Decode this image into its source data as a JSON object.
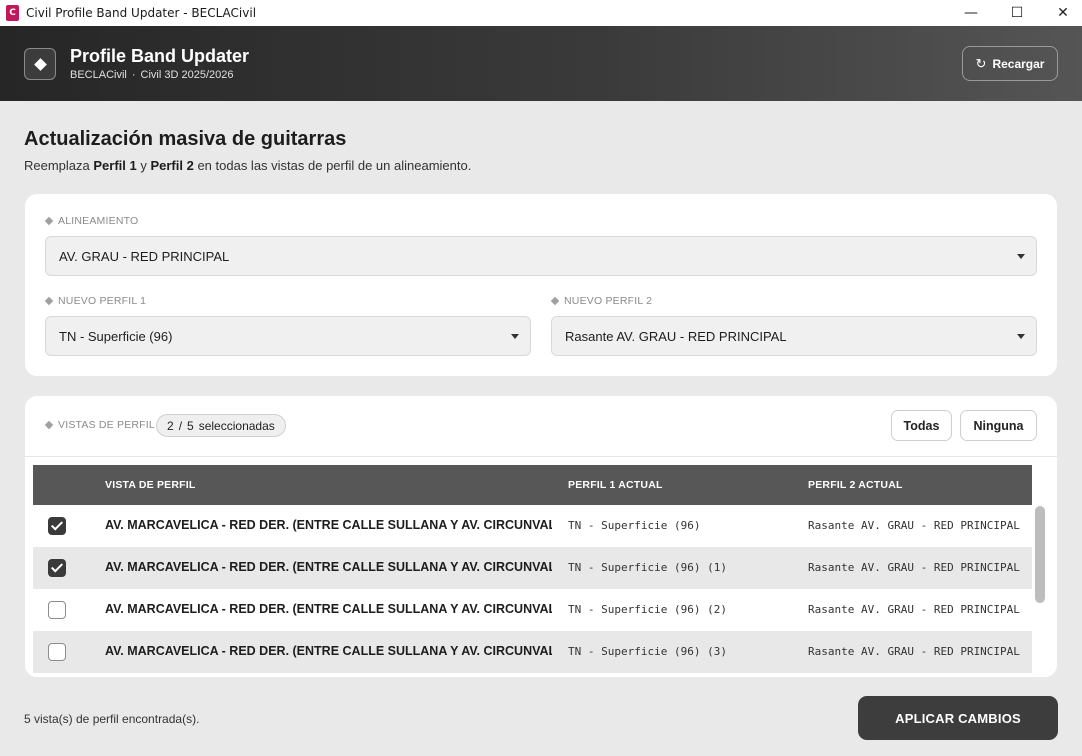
{
  "window": {
    "app_icon_label": "C",
    "title": "Civil Profile Band Updater - BECLACivil",
    "minimize": "—",
    "maximize": "☐",
    "close": "✕"
  },
  "header": {
    "title": "Profile Band Updater",
    "org": "BECLACivil",
    "separator": "·",
    "version": "Civil 3D 2025/2026",
    "reload_icon": "↻",
    "reload_label": "Recargar"
  },
  "page": {
    "title": "Actualización masiva de guitarras",
    "desc_prefix": "Reemplaza ",
    "desc_b1": "Perfil 1",
    "desc_mid": " y ",
    "desc_b2": "Perfil 2",
    "desc_suffix": " en todas las vistas de perfil de un alineamiento."
  },
  "form": {
    "alignment_label": "ALINEAMIENTO",
    "alignment_value": "AV. GRAU - RED PRINCIPAL",
    "profile1_label": "NUEVO PERFIL 1",
    "profile1_value": "TN - Superficie (96)",
    "profile2_label": "NUEVO PERFIL 2",
    "profile2_value": "Rasante AV. GRAU - RED PRINCIPAL"
  },
  "views": {
    "label": "VISTAS DE PERFIL",
    "selected_count": "2",
    "count_sep": "/",
    "total_count": "5",
    "count_suffix": "seleccionadas",
    "all_button": "Todas",
    "none_button": "Ninguna",
    "columns": [
      "VISTA DE PERFIL",
      "PERFIL 1 ACTUAL",
      "PERFIL 2 ACTUAL"
    ],
    "rows": [
      {
        "checked": true,
        "name": "AV. MARCAVELICA - RED DER. (ENTRE CALLE SULLANA Y AV. CIRCUNVALACION)",
        "profile1": "TN - Superficie (96)",
        "profile2": "Rasante AV. GRAU - RED PRINCIPAL"
      },
      {
        "checked": true,
        "name": "AV. MARCAVELICA - RED DER. (ENTRE CALLE SULLANA Y AV. CIRCUNVALACION)",
        "profile1": "TN - Superficie (96) (1)",
        "profile2": "Rasante AV. GRAU - RED PRINCIPAL"
      },
      {
        "checked": false,
        "name": "AV. MARCAVELICA - RED DER. (ENTRE CALLE SULLANA Y AV. CIRCUNVALACION)",
        "profile1": "TN - Superficie (96) (2)",
        "profile2": "Rasante AV. GRAU - RED PRINCIPAL"
      },
      {
        "checked": false,
        "name": "AV. MARCAVELICA - RED DER. (ENTRE CALLE SULLANA Y AV. CIRCUNVALACION)",
        "profile1": "TN - Superficie (96) (3)",
        "profile2": "Rasante AV. GRAU - RED PRINCIPAL"
      }
    ]
  },
  "footer": {
    "status": "5 vista(s) de perfil encontrada(s).",
    "apply_label": "APLICAR CAMBIOS"
  }
}
